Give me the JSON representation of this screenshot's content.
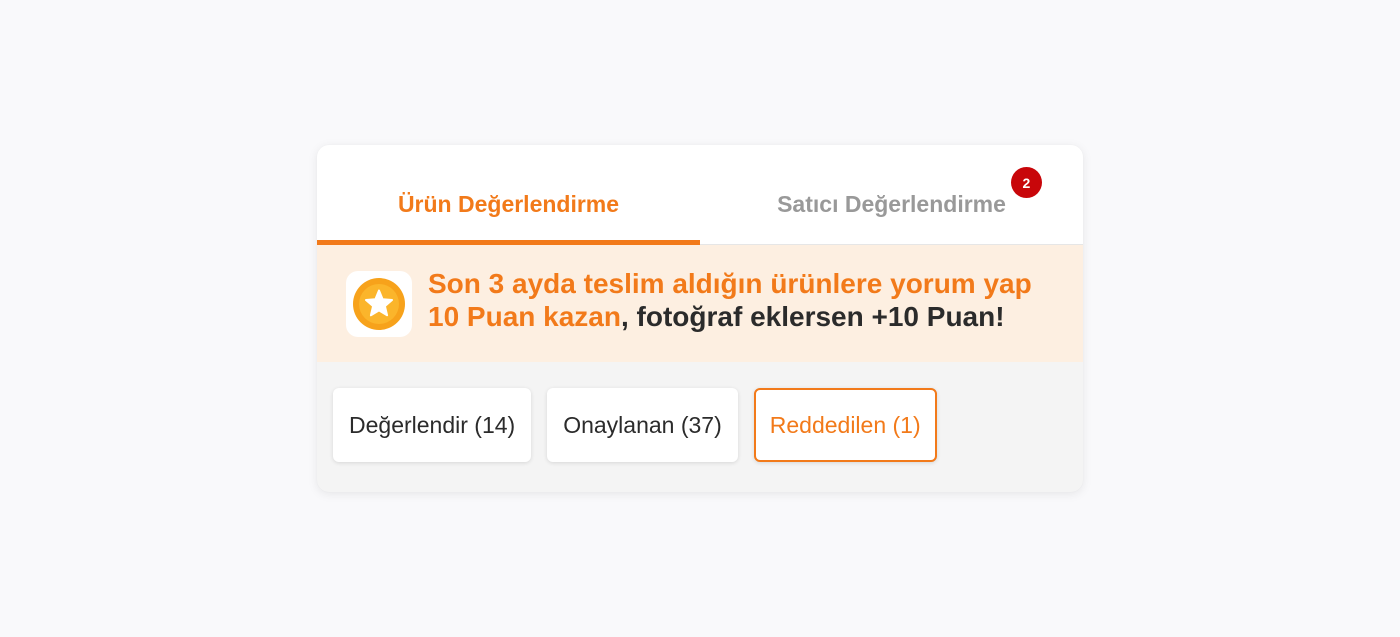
{
  "tabs": [
    {
      "label": "Ürün Değerlendirme",
      "active": true
    },
    {
      "label": "Satıcı Değerlendirme",
      "active": false,
      "badge": "2"
    }
  ],
  "promo": {
    "icon": "star-coin-icon",
    "highlight": "Son 3 ayda teslim aldığın ürünlere yorum yap 10 Puan kazan",
    "rest": ", fotoğraf eklersen +10 Puan!"
  },
  "filters": [
    {
      "label": "Değerlendir (14)",
      "selected": false
    },
    {
      "label": "Onaylanan (37)",
      "selected": false
    },
    {
      "label": "Reddedilen (1)",
      "selected": true
    }
  ],
  "colors": {
    "accent": "#f27a1a",
    "badge": "#c8060a",
    "promo_bg": "#fdefe1",
    "coin": "#f7a21b"
  }
}
